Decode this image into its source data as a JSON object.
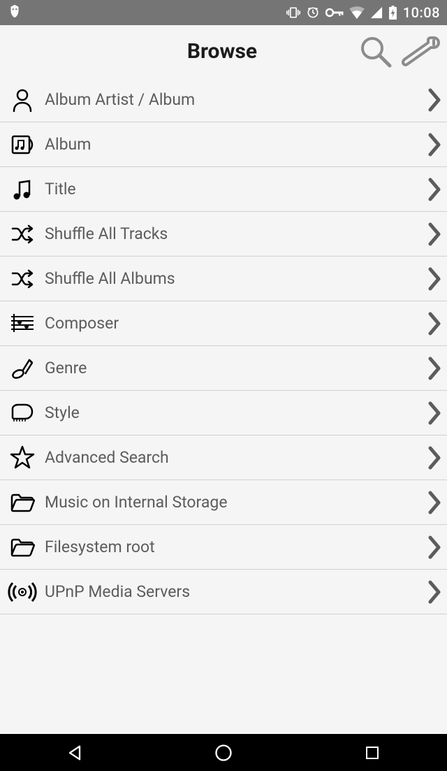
{
  "status_bar": {
    "time": "10:08"
  },
  "header": {
    "title": "Browse"
  },
  "browse_items": [
    {
      "icon": "artist",
      "label": "Album Artist / Album"
    },
    {
      "icon": "album",
      "label": "Album"
    },
    {
      "icon": "title",
      "label": "Title"
    },
    {
      "icon": "shuffle",
      "label": "Shuffle All Tracks"
    },
    {
      "icon": "shuffle",
      "label": "Shuffle All Albums"
    },
    {
      "icon": "composer",
      "label": "Composer"
    },
    {
      "icon": "genre",
      "label": "Genre"
    },
    {
      "icon": "style",
      "label": "Style"
    },
    {
      "icon": "star",
      "label": "Advanced Search"
    },
    {
      "icon": "folder",
      "label": "Music on Internal Storage"
    },
    {
      "icon": "folder",
      "label": "Filesystem root"
    },
    {
      "icon": "upnp",
      "label": "UPnP Media Servers"
    }
  ]
}
